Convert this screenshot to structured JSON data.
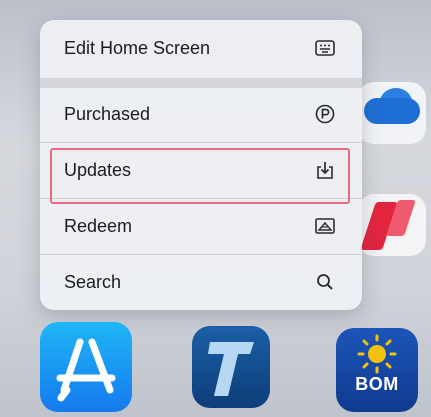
{
  "menu": {
    "items": [
      {
        "label": "Edit Home Screen",
        "icon": "home-screen-edit-icon"
      },
      {
        "label": "Purchased",
        "icon": "purchased-p-icon"
      },
      {
        "label": "Updates",
        "icon": "download-tray-icon"
      },
      {
        "label": "Redeem",
        "icon": "redeem-card-icon"
      },
      {
        "label": "Search",
        "icon": "search-icon"
      }
    ],
    "highlighted_item": "Updates",
    "highlight_color": "#e86a85"
  },
  "dock": {
    "apps": [
      {
        "name": "App Store",
        "icon": "app-store-icon"
      },
      {
        "name": "Telstra",
        "icon": "telstra-icon"
      },
      {
        "name": "BOM",
        "icon": "bom-icon",
        "label": "BOM"
      }
    ]
  },
  "background_apps": [
    "OneDrive",
    "News"
  ],
  "colors": {
    "menu_bg": "#eef0f4",
    "app_store_blue": "#1579ee",
    "telstra_blue": "#0d3e78",
    "bom_blue": "#0f3a90",
    "bom_sun": "#f4c20d"
  }
}
